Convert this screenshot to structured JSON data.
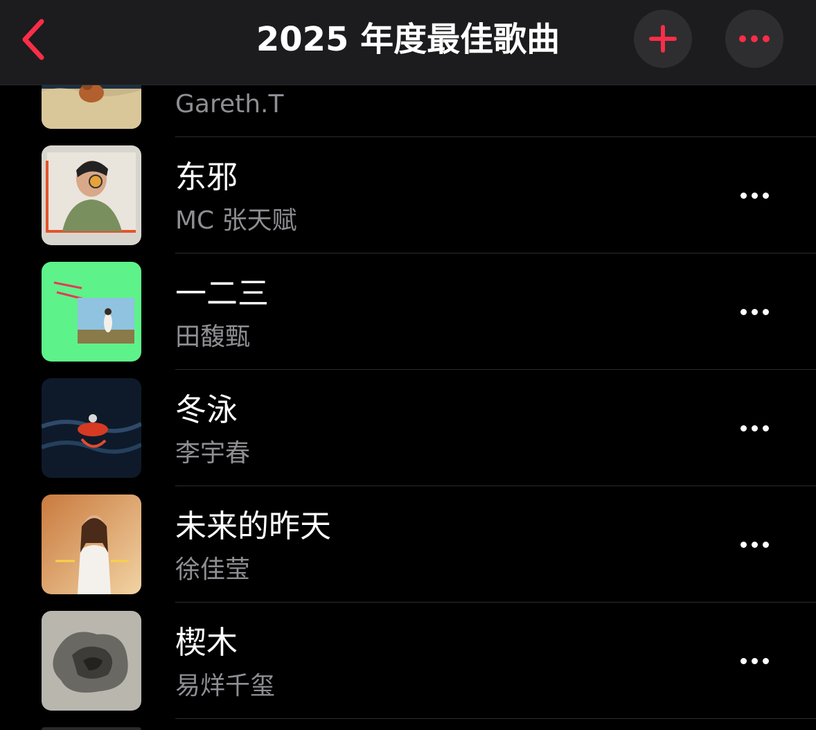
{
  "header": {
    "title": "2025 年度最佳歌曲",
    "back_icon": "chevron-left-icon",
    "add_icon": "plus-icon",
    "more_icon": "ellipsis-icon",
    "accent_color": "#fa2d48"
  },
  "songs": [
    {
      "title": "",
      "artist": "Gareth.T",
      "artwork_color": "#c9b68a"
    },
    {
      "title": "东邪",
      "artist": "MC 张天赋",
      "artwork_color": "#d8d5cf"
    },
    {
      "title": "一二三",
      "artist": "田馥甄",
      "artwork_color": "#5ef28a"
    },
    {
      "title": "冬泳",
      "artist": "李宇春",
      "artwork_color": "#0e1a2a"
    },
    {
      "title": "未来的昨天",
      "artist": "徐佳莹",
      "artwork_color": "#e8b27a"
    },
    {
      "title": "楔木",
      "artist": "易烊千玺",
      "artwork_color": "#9a968e"
    }
  ]
}
